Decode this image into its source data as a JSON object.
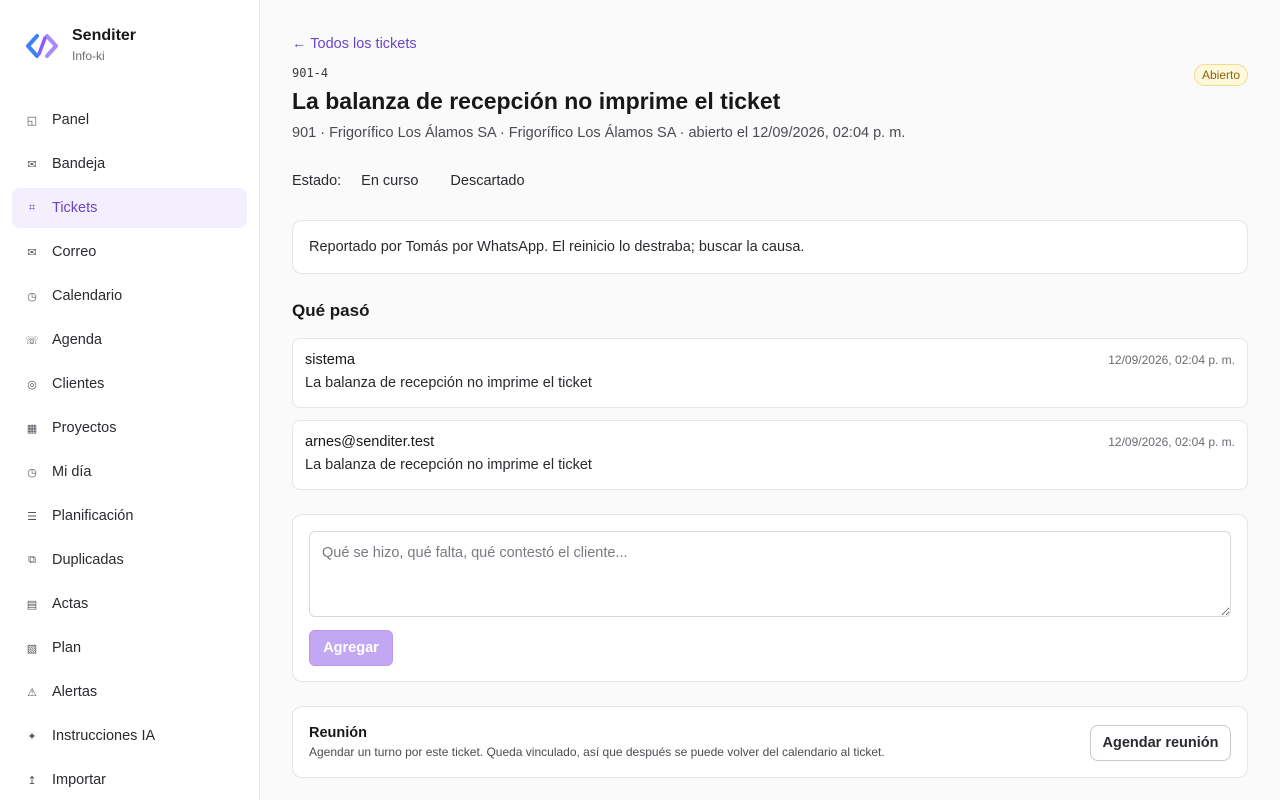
{
  "brand": {
    "name": "Senditer",
    "workspace": "Info-ki",
    "accent": "#6b44c9"
  },
  "sidebar": {
    "items": [
      {
        "label": "Panel",
        "icon": "panel-icon",
        "glyph": "◱"
      },
      {
        "label": "Bandeja",
        "icon": "inbox-icon",
        "glyph": "✉"
      },
      {
        "label": "Tickets",
        "icon": "ticket-icon",
        "glyph": "⌗",
        "active": true
      },
      {
        "label": "Correo",
        "icon": "mail-icon",
        "glyph": "✉"
      },
      {
        "label": "Calendario",
        "icon": "clock-icon",
        "glyph": "◷"
      },
      {
        "label": "Agenda",
        "icon": "phone-icon",
        "glyph": "☏"
      },
      {
        "label": "Clientes",
        "icon": "clients-icon",
        "glyph": "◎"
      },
      {
        "label": "Proyectos",
        "icon": "projects-icon",
        "glyph": "▦"
      },
      {
        "label": "Mi día",
        "icon": "my-day-icon",
        "glyph": "◷"
      },
      {
        "label": "Planificación",
        "icon": "planning-icon",
        "glyph": "☰"
      },
      {
        "label": "Duplicadas",
        "icon": "duplicates-icon",
        "glyph": "⧉"
      },
      {
        "label": "Actas",
        "icon": "minutes-icon",
        "glyph": "▤"
      },
      {
        "label": "Plan",
        "icon": "plan-icon",
        "glyph": "▧"
      },
      {
        "label": "Alertas",
        "icon": "alert-icon",
        "glyph": "⚠"
      },
      {
        "label": "Instrucciones IA",
        "icon": "sparkle-icon",
        "glyph": "✦"
      },
      {
        "label": "Importar",
        "icon": "import-icon",
        "glyph": "↥"
      }
    ]
  },
  "ticket": {
    "back_label": "← Todos los tickets",
    "code": "901-4",
    "status": "Abierto",
    "title": "La balanza de recepción no imprime el ticket",
    "meta": "901 · Frigorífico Los Álamos SA · Frigorífico Los Álamos SA · abierto el 12/09/2026, 02:04 p. m.",
    "state_label": "Estado:",
    "state_options": [
      "En curso",
      "Descartado"
    ],
    "note": "Reportado por Tomás por WhatsApp. El reinicio lo destraba; buscar la causa."
  },
  "history": {
    "title": "Qué pasó",
    "events": [
      {
        "author": "sistema",
        "time": "12/09/2026, 02:04 p. m.",
        "text": "La balanza de recepción no imprime el ticket"
      },
      {
        "author": "arnes@senditer.test",
        "time": "12/09/2026, 02:04 p. m.",
        "text": "La balanza de recepción no imprime el ticket"
      }
    ]
  },
  "comment": {
    "placeholder": "Qué se hizo, qué falta, qué contestó el cliente...",
    "value": "",
    "submit_label": "Agregar"
  },
  "meeting": {
    "title": "Reunión",
    "description": "Agendar un turno por este ticket. Queda vinculado, así que después se puede volver del calendario al ticket.",
    "button_label": "Agendar reunión"
  }
}
